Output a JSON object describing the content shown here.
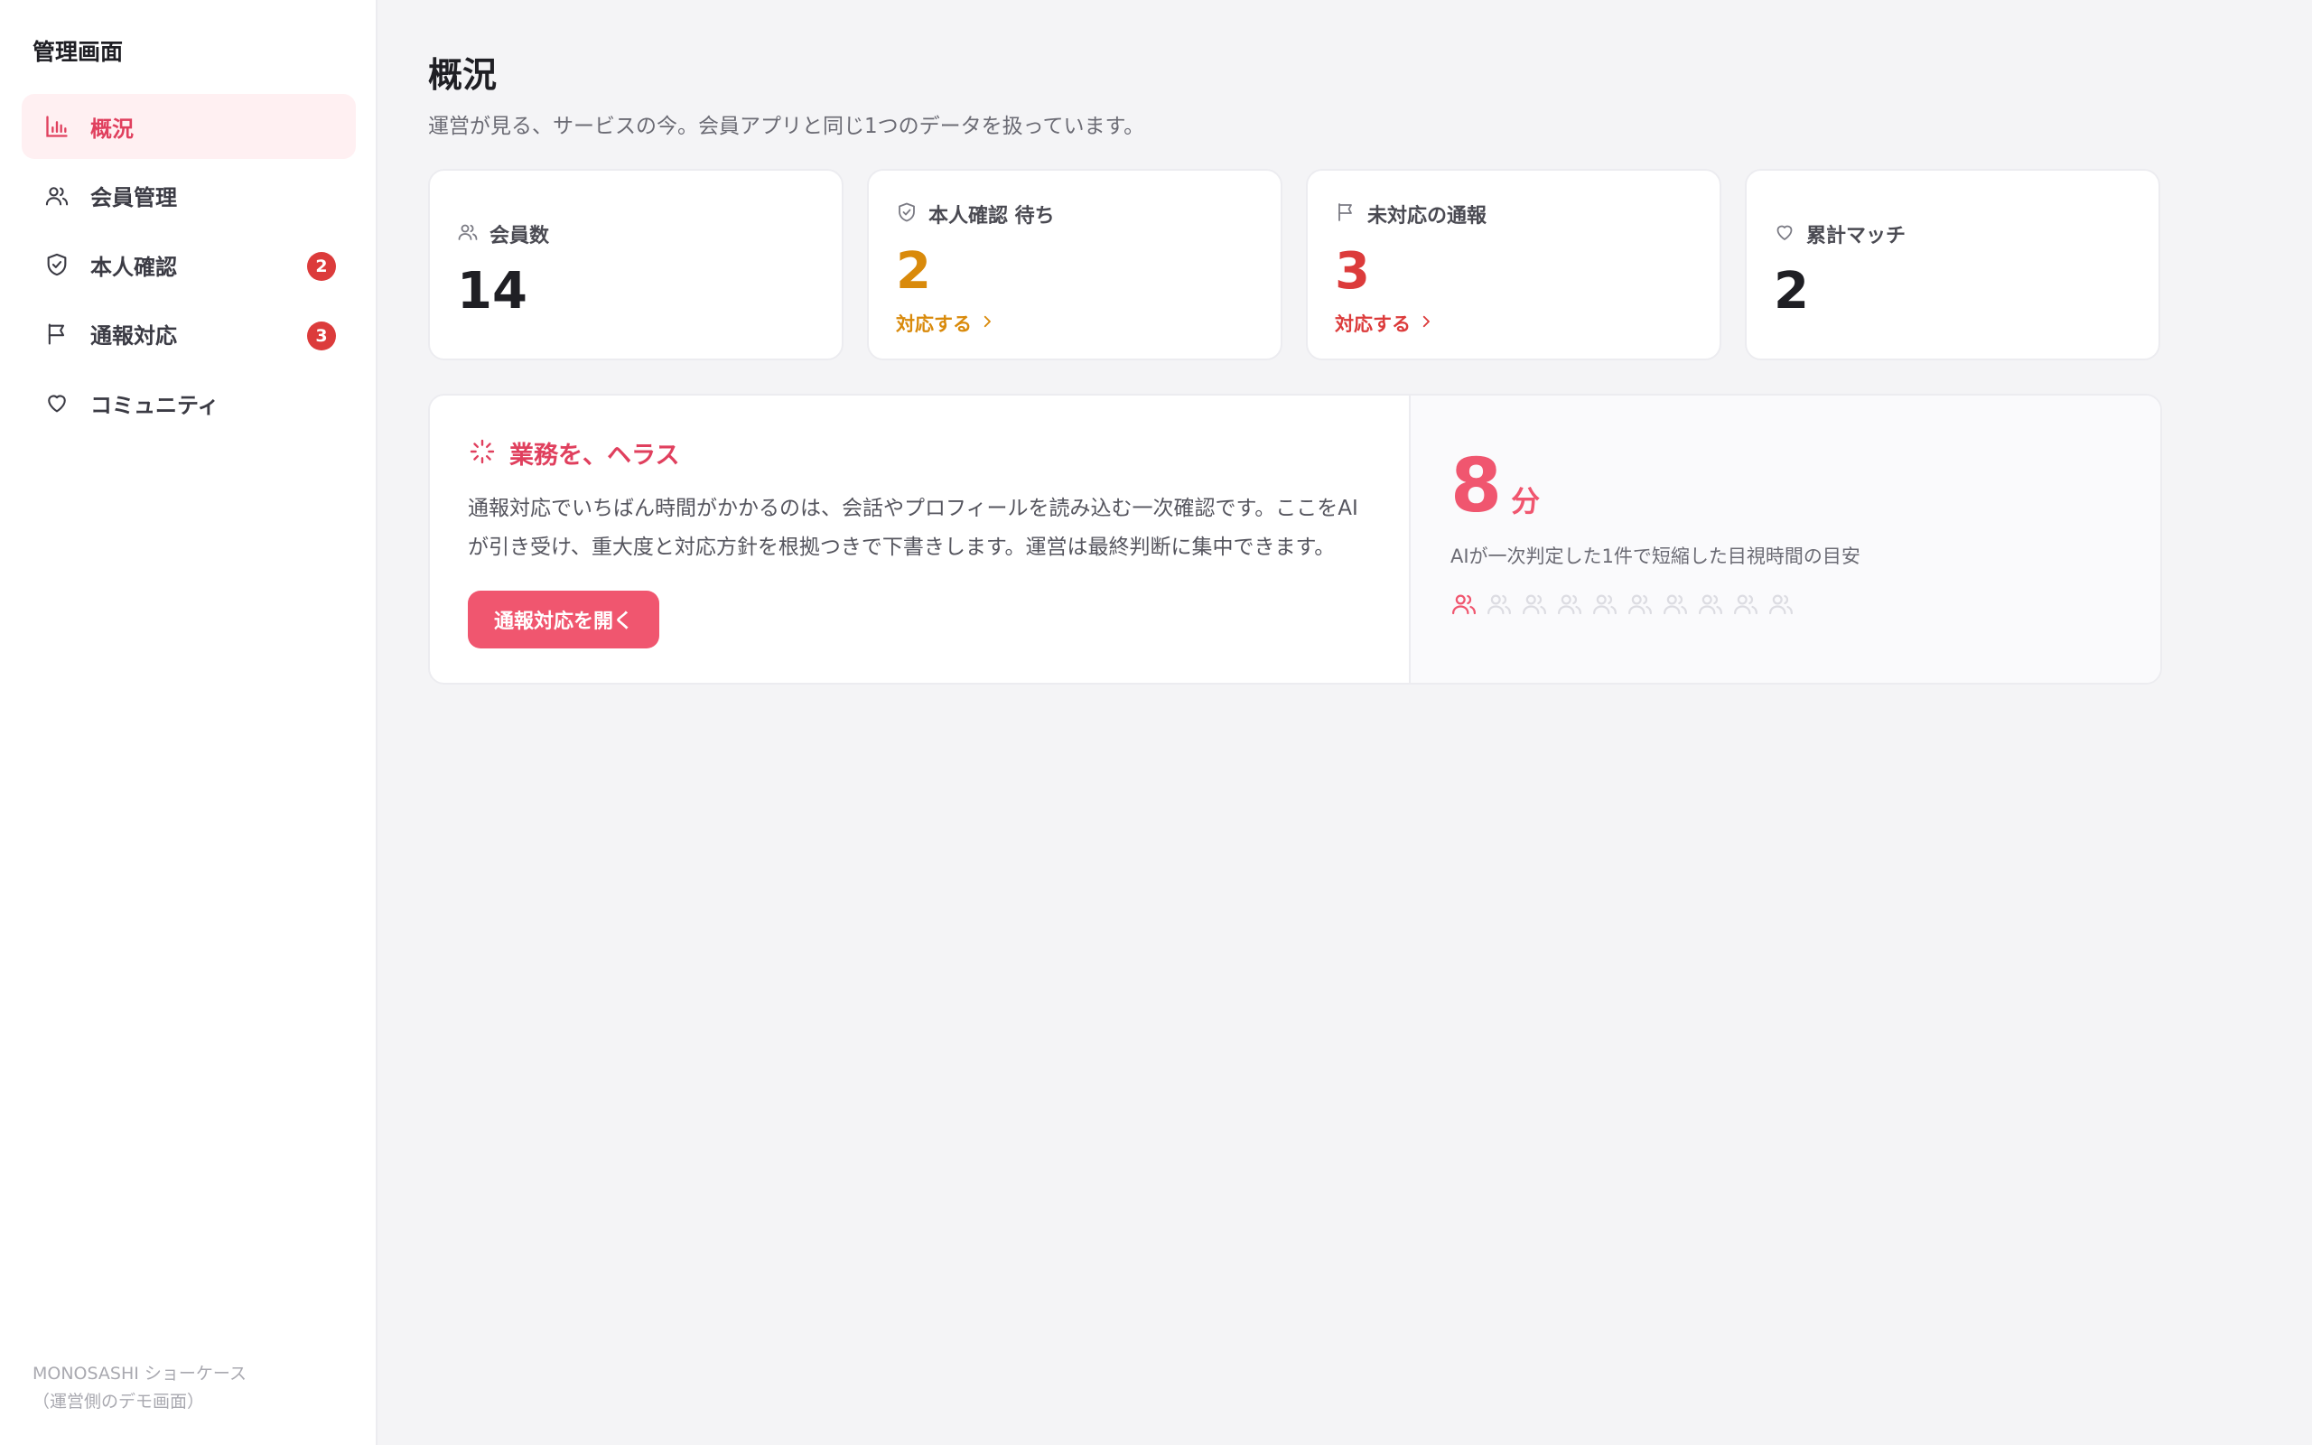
{
  "sidebar": {
    "title": "管理画面",
    "items": [
      {
        "label": "概況",
        "icon": "bar-chart-icon",
        "active": true,
        "badge": null
      },
      {
        "label": "会員管理",
        "icon": "users-icon",
        "active": false,
        "badge": null
      },
      {
        "label": "本人確認",
        "icon": "shield-check-icon",
        "active": false,
        "badge": "2"
      },
      {
        "label": "通報対応",
        "icon": "flag-icon",
        "active": false,
        "badge": "3"
      },
      {
        "label": "コミュニティ",
        "icon": "heart-icon",
        "active": false,
        "badge": null
      }
    ],
    "footer_line1": "MONOSASHI ショーケース",
    "footer_line2": "（運営側のデモ画面）"
  },
  "page": {
    "title": "概況",
    "subtitle": "運営が見る、サービスの今。会員アプリと同じ1つのデータを扱っています。"
  },
  "stats": [
    {
      "label": "会員数",
      "icon": "users-icon",
      "value": "14",
      "link": null,
      "color": "#1f1f24"
    },
    {
      "label": "本人確認 待ち",
      "icon": "shield-check-icon",
      "value": "2",
      "link": "対応する",
      "color": "#d98a0b"
    },
    {
      "label": "未対応の通報",
      "icon": "flag-icon",
      "value": "3",
      "link": "対応する",
      "color": "#dc3b3b"
    },
    {
      "label": "累計マッチ",
      "icon": "heart-icon",
      "value": "2",
      "link": null,
      "color": "#1f1f24"
    }
  ],
  "feature": {
    "title": "業務を、ヘラス",
    "description": "通報対応でいちばん時間がかかるのは、会話やプロフィールを読み込む一次確認です。ここをAIが引き受け、重大度と対応方針を根拠つきで下書きします。運営は最終判断に集中できます。",
    "button_label": "通報対応を開く",
    "metric_value": "8",
    "metric_unit": "分",
    "metric_caption": "AIが一次判定した1件で短縮した目視時間の目安",
    "people_total": 10,
    "people_highlighted": 1
  },
  "colors": {
    "accent": "#f0566f",
    "accent_text": "#e0405e",
    "warning": "#d98a0b",
    "danger": "#dc3b3b"
  }
}
